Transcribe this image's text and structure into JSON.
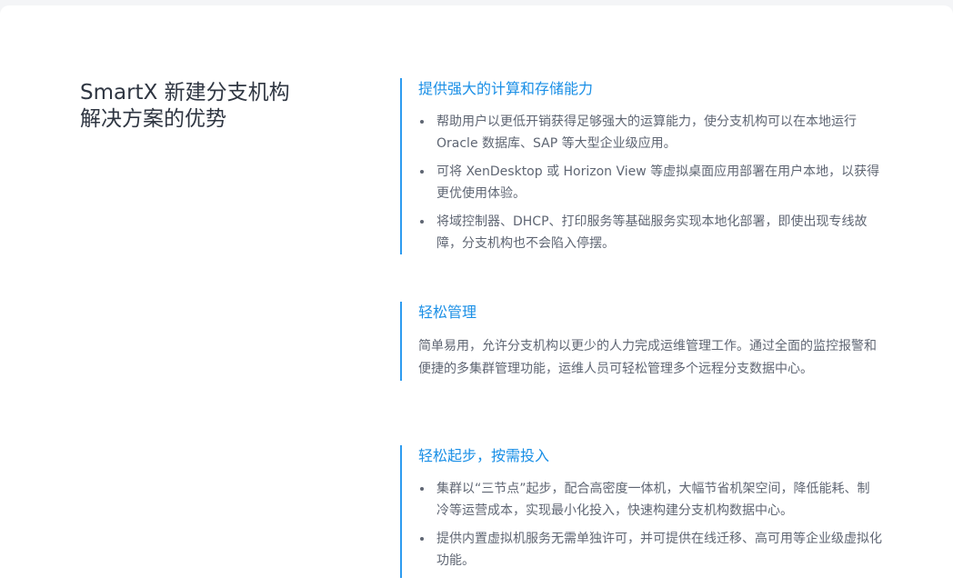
{
  "heading": {
    "line1": "SmartX 新建分支机构",
    "line2": "解决方案的优势"
  },
  "sections": [
    {
      "title": "提供强大的计算和存储能力",
      "items": [
        "帮助用户以更低开销获得足够强大的运算能力，使分支机构可以在本地运行 Oracle 数据库、SAP 等大型企业级应用。",
        "可将 XenDesktop 或 Horizon View 等虚拟桌面应用部署在用户本地，以获得更优使用体验。",
        "将域控制器、DHCP、打印服务等基础服务实现本地化部署，即使出现专线故障，分支机构也不会陷入停摆。"
      ]
    },
    {
      "title": "轻松管理",
      "text": "简单易用，允许分支机构以更少的人力完成运维管理工作。通过全面的监控报警和便捷的多集群管理功能，运维人员可轻松管理多个远程分支数据中心。"
    },
    {
      "title": "轻松起步，按需投入",
      "items": [
        "集群以“三节点”起步，配合高密度一体机，大幅节省机架空间，降低能耗、制冷等运营成本，实现最小化投入，快速构建分支机构数据中心。",
        "提供内置虚拟机服务无需单独许可，并可提供在线迁移、高可用等企业级虚拟化功能。"
      ]
    }
  ]
}
